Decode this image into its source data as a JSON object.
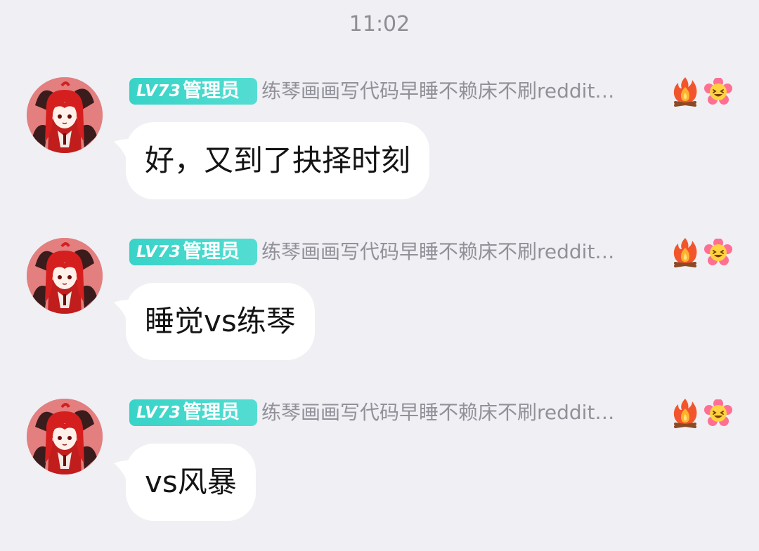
{
  "chat": {
    "timestamp": "11:02",
    "messages": [
      {
        "level": "LV73",
        "role": "管理员",
        "title": "练琴画画写代码早睡不赖床不刷reddit…",
        "badges": [
          "fire-icon",
          "smiling-flower-icon"
        ],
        "text": "好，又到了抉择时刻"
      },
      {
        "level": "LV73",
        "role": "管理员",
        "title": "练琴画画写代码早睡不赖床不刷reddit…",
        "badges": [
          "fire-icon",
          "smiling-flower-icon"
        ],
        "text": "睡觉vs练琴"
      },
      {
        "level": "LV73",
        "role": "管理员",
        "title": "练琴画画写代码早睡不赖床不刷reddit…",
        "badges": [
          "fire-icon",
          "smiling-flower-icon"
        ],
        "text": "vs风暴"
      }
    ]
  },
  "colors": {
    "background": "#efeff4",
    "badge_teal": "#3fd6ca",
    "title_gray": "#919199",
    "bubble": "#ffffff"
  }
}
